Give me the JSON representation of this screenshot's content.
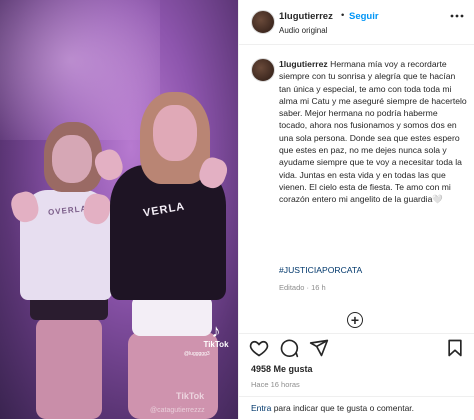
{
  "header": {
    "username": "1lugutierrez",
    "separator": "•",
    "follow_label": "Seguir",
    "audio_label": "Audio original",
    "more_icon": "more-horizontal-icon"
  },
  "media": {
    "tiktok_label": "TikTok",
    "tiktok_user": "@luggggg3",
    "tiktok_bottom_label": "TikTok",
    "watermark": "@catagutierrezzz",
    "shirt_left_text": "OVERLA",
    "shirt_right_text": "VERLA"
  },
  "caption": {
    "username": "1lugutierrez",
    "text": "Hermana mía voy a recordarte siempre con tu sonrisa y alegría que te hacían tan única y especial, te amo con toda toda mi alma mi Catu y me aseguré siempre de hacertelo saber. Mejor hermana no podría haberme tocado, ahora nos fusionamos y somos dos en una sola persona. Donde sea que estes espero que estes en paz, no me dejes nunca sola y ayudame siempre que te voy a necesitar toda la vida. Juntas en esta vida y en todas las que vienen. El cielo esta de fiesta. Te amo con mi corazón entero mi angelito de la guardia🤍",
    "hashtag": "#JUSTICIAPORCATA",
    "edited": "Editado · 16 h"
  },
  "load_more_icon": "plus-circle-icon",
  "actions": {
    "like_icon": "heart-icon",
    "comment_icon": "comment-icon",
    "share_icon": "send-icon",
    "save_icon": "bookmark-icon"
  },
  "stats": {
    "likes": "4958 Me gusta",
    "time": "Hace 16 horas"
  },
  "comment": {
    "link_text": "Entra",
    "rest_text": " para indicar que te gusta o comentar."
  },
  "colors": {
    "follow": "#0095f6",
    "hashtag": "#00376b",
    "muted": "#8e8e8e"
  }
}
